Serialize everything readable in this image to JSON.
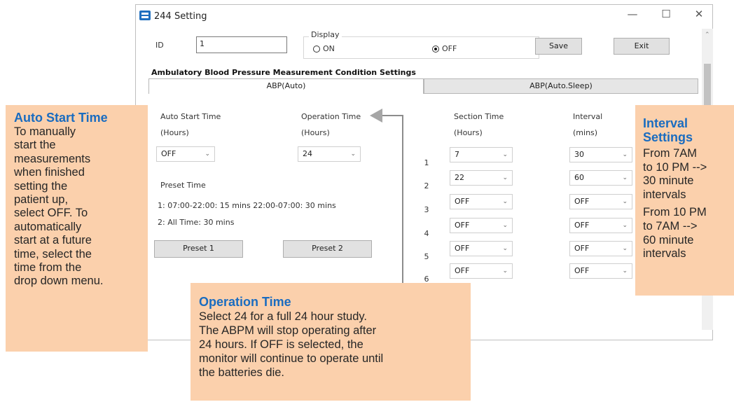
{
  "window": {
    "title": "244 Setting",
    "controls": {
      "minimize": "—",
      "maximize": "☐",
      "close": "✕"
    }
  },
  "id_field": {
    "label": "ID",
    "value": "1"
  },
  "display": {
    "label": "Display",
    "options": [
      {
        "label": "ON",
        "selected": false
      },
      {
        "label": "OFF",
        "selected": true
      }
    ]
  },
  "buttons": {
    "save": "Save",
    "exit": "Exit",
    "preset1": "Preset 1",
    "preset2": "Preset 2"
  },
  "section_title": "Ambulatory Blood Pressure Measurement Condition Settings",
  "tabs": [
    {
      "label": "ABP(Auto)",
      "active": true
    },
    {
      "label": "ABP(Auto.Sleep)",
      "active": false
    }
  ],
  "auto_start": {
    "label": "Auto Start Time",
    "unit": "(Hours)",
    "value": "OFF"
  },
  "operation": {
    "label": "Operation Time",
    "unit": "(Hours)",
    "value": "24"
  },
  "preset": {
    "label": "Preset Time",
    "line1": "1: 07:00-22:00: 15 mins 22:00-07:00: 30 mins",
    "line2": "2: All Time: 30 mins"
  },
  "section_time": {
    "label": "Section Time",
    "unit": "(Hours)"
  },
  "interval": {
    "label": "Interval",
    "unit": "(mins)"
  },
  "rows": [
    {
      "num": "1",
      "section": "7",
      "interval": "30"
    },
    {
      "num": "2",
      "section": "22",
      "interval": "60"
    },
    {
      "num": "3",
      "section": "OFF",
      "interval": "OFF"
    },
    {
      "num": "4",
      "section": "OFF",
      "interval": "OFF"
    },
    {
      "num": "5",
      "section": "OFF",
      "interval": "OFF"
    },
    {
      "num": "6",
      "section": "OFF",
      "interval": "OFF"
    }
  ],
  "callouts": {
    "auto_start": {
      "title": "Auto Start Time",
      "lines": [
        "To manually",
        "start the",
        "measurements",
        "when finished",
        "setting the",
        "patient up,",
        "select OFF.  To",
        "automatically",
        "start at a future",
        "time, select the",
        "time from the",
        "drop down menu."
      ]
    },
    "operation": {
      "title": "Operation Time",
      "lines": [
        "Select 24 for a full 24 hour study.",
        "The ABPM will stop operating after",
        "24 hours.  If OFF is selected, the",
        "monitor will continue to operate until",
        "the batteries die."
      ]
    },
    "interval": {
      "title_lines": [
        "Interval",
        "Settings"
      ],
      "block1": [
        "From 7AM",
        "to 10 PM -->",
        "30 minute",
        "intervals"
      ],
      "block2": [
        "From 10 PM",
        "to 7AM -->",
        "60 minute",
        "intervals"
      ]
    }
  },
  "colors": {
    "callout_bg": "#fbd0ac",
    "callout_title": "#1a6cc0",
    "arrow": "#8c8c8c"
  },
  "icons": {
    "dropdown": "chevron-down-icon",
    "arrow": "left-arrow-icon",
    "app": "app-icon"
  }
}
